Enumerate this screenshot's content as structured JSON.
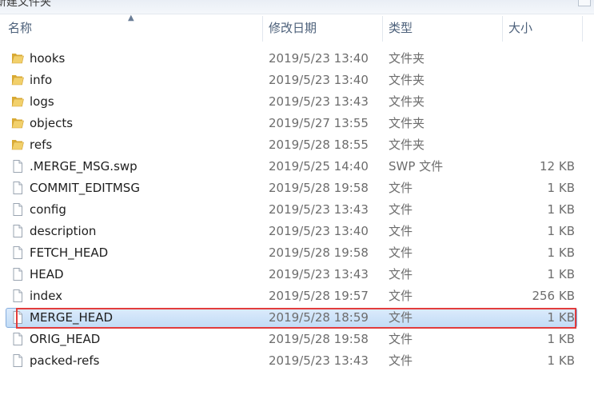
{
  "window": {
    "title": "新建文件夹"
  },
  "columns": {
    "name": "名称",
    "date": "修改日期",
    "type": "类型",
    "size": "大小"
  },
  "files": [
    {
      "name": "hooks",
      "date": "2019/5/23 13:40",
      "type": "文件夹",
      "size": "",
      "icon": "folder-icon"
    },
    {
      "name": "info",
      "date": "2019/5/23 13:40",
      "type": "文件夹",
      "size": "",
      "icon": "folder-icon"
    },
    {
      "name": "logs",
      "date": "2019/5/23 13:43",
      "type": "文件夹",
      "size": "",
      "icon": "folder-icon"
    },
    {
      "name": "objects",
      "date": "2019/5/27 13:55",
      "type": "文件夹",
      "size": "",
      "icon": "folder-icon"
    },
    {
      "name": "refs",
      "date": "2019/5/28 18:55",
      "type": "文件夹",
      "size": "",
      "icon": "folder-icon"
    },
    {
      "name": ".MERGE_MSG.swp",
      "date": "2019/5/25 14:40",
      "type": "SWP 文件",
      "size": "12 KB",
      "icon": "file-icon"
    },
    {
      "name": "COMMIT_EDITMSG",
      "date": "2019/5/28 19:58",
      "type": "文件",
      "size": "1 KB",
      "icon": "file-icon"
    },
    {
      "name": "config",
      "date": "2019/5/23 13:43",
      "type": "文件",
      "size": "1 KB",
      "icon": "file-icon"
    },
    {
      "name": "description",
      "date": "2019/5/23 13:40",
      "type": "文件",
      "size": "1 KB",
      "icon": "file-icon"
    },
    {
      "name": "FETCH_HEAD",
      "date": "2019/5/28 19:58",
      "type": "文件",
      "size": "1 KB",
      "icon": "file-icon"
    },
    {
      "name": "HEAD",
      "date": "2019/5/23 13:43",
      "type": "文件",
      "size": "1 KB",
      "icon": "file-icon"
    },
    {
      "name": "index",
      "date": "2019/5/28 19:57",
      "type": "文件",
      "size": "256 KB",
      "icon": "file-icon"
    },
    {
      "name": "MERGE_HEAD",
      "date": "2019/5/28 18:59",
      "type": "文件",
      "size": "1 KB",
      "icon": "file-icon",
      "selected": true
    },
    {
      "name": "ORIG_HEAD",
      "date": "2019/5/28 19:58",
      "type": "文件",
      "size": "1 KB",
      "icon": "file-icon"
    },
    {
      "name": "packed-refs",
      "date": "2019/5/23 13:43",
      "type": "文件",
      "size": "1 KB",
      "icon": "file-icon"
    }
  ],
  "colors": {
    "selection_border": "#84acdd",
    "selection_fill": "#cce1f8",
    "annotation": "#e23c3c",
    "folder": "#e8c45a"
  }
}
